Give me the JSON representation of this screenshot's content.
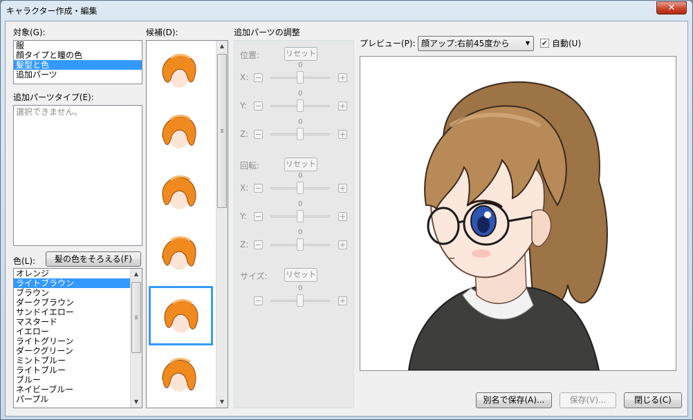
{
  "window": {
    "title": "キャラクター作成・編集",
    "close_label": "✕"
  },
  "target": {
    "label": "対象(G):",
    "items": [
      "服",
      "顔タイプと瞳の色",
      "髪型と色",
      "追加パーツ"
    ],
    "selected_index": 2
  },
  "extra_parts_type": {
    "label": "追加パーツタイプ(E):",
    "placeholder": "選択できません。"
  },
  "color": {
    "label": "色(L):",
    "match_button": "髪の色をそろえる(F)",
    "items": [
      "オレンジ",
      "ライトブラウン",
      "ブラウン",
      "ダークブラウン",
      "サンドイエロー",
      "マスタード",
      "イエロー",
      "ライトグリーン",
      "ダークグリーン",
      "ミントブルー",
      "ライトブルー",
      "ブルー",
      "ネイビーブルー",
      "パープル"
    ],
    "selected_index": 1
  },
  "candidates": {
    "label": "候補(D):",
    "count": 6,
    "selected_index": 4
  },
  "adjust": {
    "title": "追加パーツの調整",
    "position_label": "位置:",
    "rotation_label": "回転:",
    "size_label": "サイズ:",
    "reset_label": "リセット",
    "axis_x": "X:",
    "axis_y": "Y:",
    "axis_z": "Z:",
    "minus": "−",
    "plus": "+",
    "zero": "0"
  },
  "preview": {
    "label": "プレビュー(P):",
    "view_selected": "顔アップ:右前45度から",
    "auto_label": "自動(U)",
    "auto_checked": true
  },
  "buttons": {
    "save_as": "別名で保存(A)...",
    "save": "保存(V)...",
    "close": "閉じる(C)"
  },
  "colors": {
    "selection": "#3399ff",
    "hair_candidate": "#f08a1e",
    "hair_preview": "#b88a58"
  }
}
